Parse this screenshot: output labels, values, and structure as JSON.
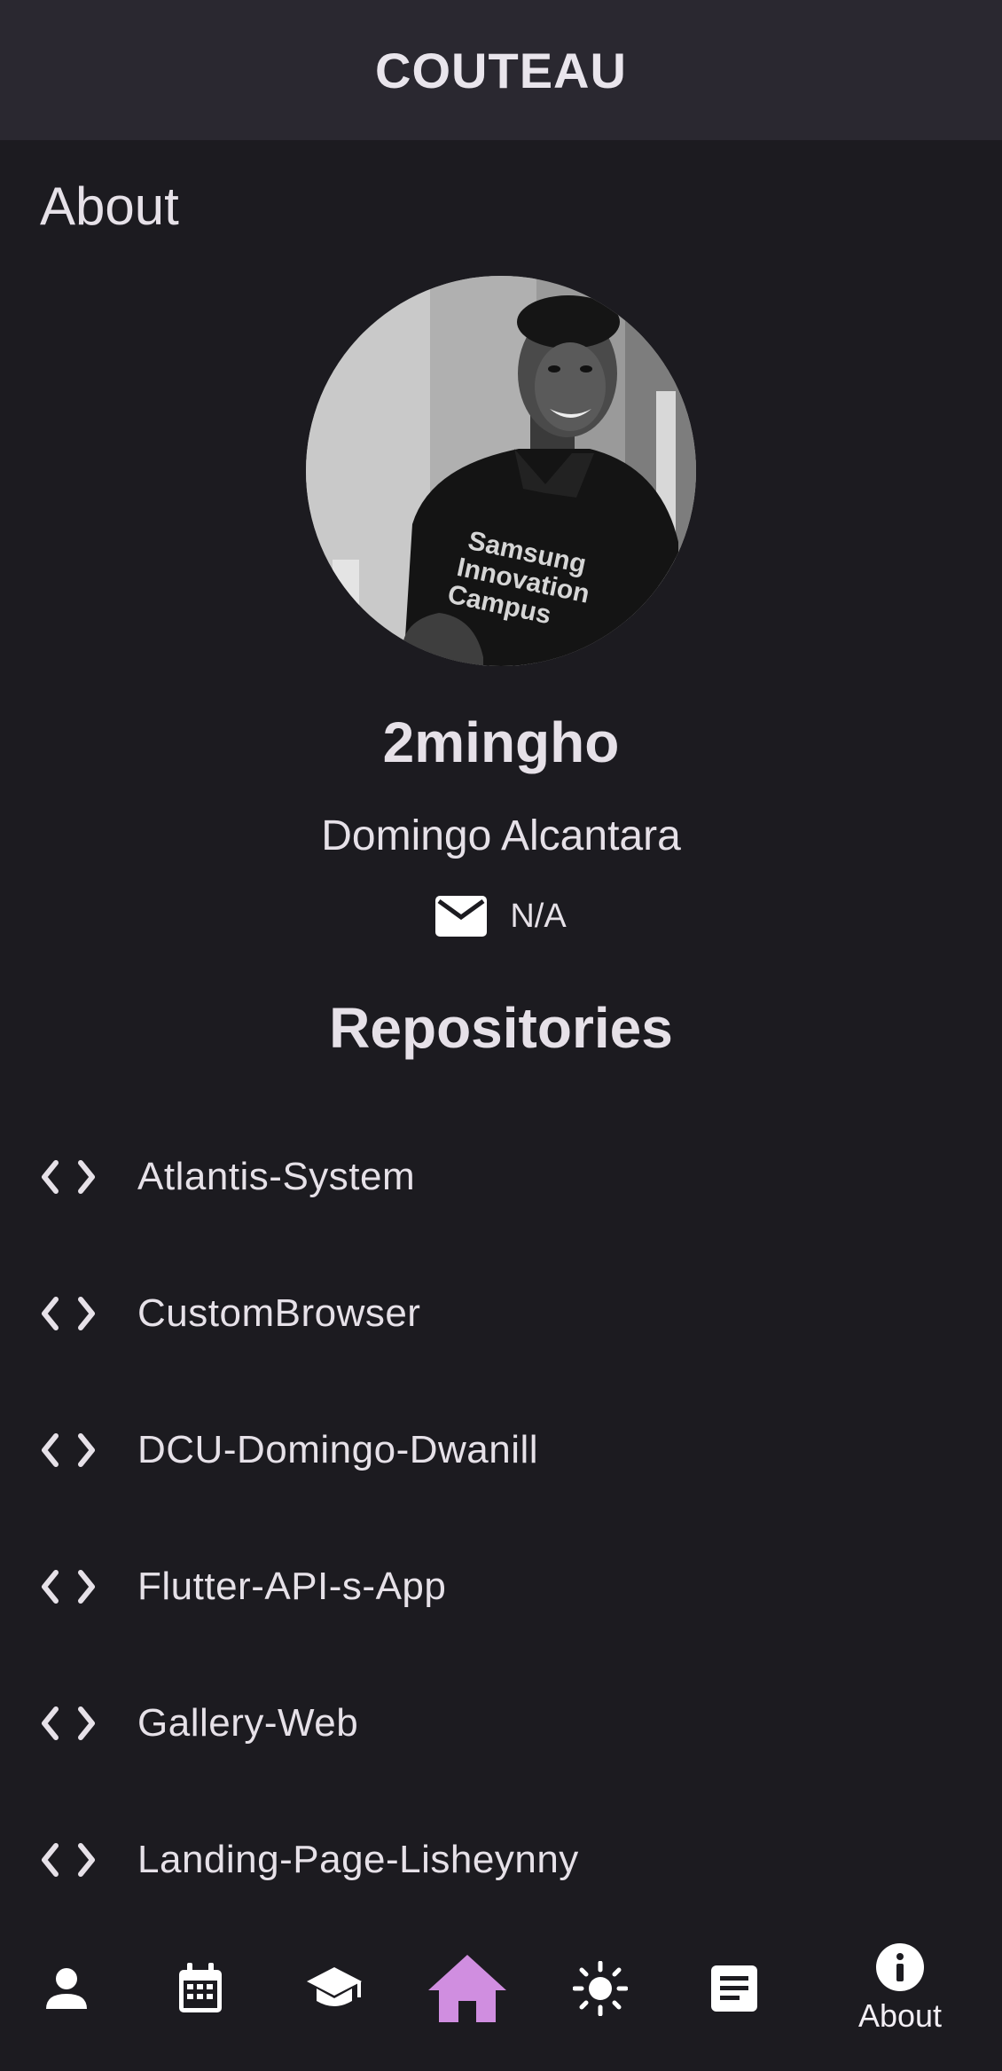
{
  "app_bar": {
    "title": "COUTEAU"
  },
  "page": {
    "heading": "About"
  },
  "profile": {
    "username": "2mingho",
    "full_name": "Domingo Alcantara",
    "email": "N/A",
    "email_icon": "mail-icon",
    "shirt_text": [
      "Samsung",
      "Innovation",
      "Campus"
    ]
  },
  "repositories": {
    "heading": "Repositories",
    "icon": "code-icon",
    "items": [
      {
        "name": "Atlantis-System"
      },
      {
        "name": "CustomBrowser"
      },
      {
        "name": "DCU-Domingo-Dwanill"
      },
      {
        "name": "Flutter-API-s-App"
      },
      {
        "name": "Gallery-Web"
      },
      {
        "name": "Landing-Page-Lisheynny"
      }
    ]
  },
  "bottom_nav": {
    "items": [
      {
        "icon": "person-icon",
        "label": "",
        "selected": false
      },
      {
        "icon": "calendar-icon",
        "label": "",
        "selected": false
      },
      {
        "icon": "school-icon",
        "label": "",
        "selected": false
      },
      {
        "icon": "home-icon",
        "label": "",
        "selected": false,
        "color": "#d08ee0"
      },
      {
        "icon": "sun-icon",
        "label": "",
        "selected": false
      },
      {
        "icon": "article-icon",
        "label": "",
        "selected": false
      },
      {
        "icon": "info-icon",
        "label": "About",
        "selected": true
      }
    ]
  },
  "colors": {
    "background": "#1c1b20",
    "app_bar": "#2a2830",
    "text": "#e6e1e8",
    "accent": "#d08ee0"
  }
}
